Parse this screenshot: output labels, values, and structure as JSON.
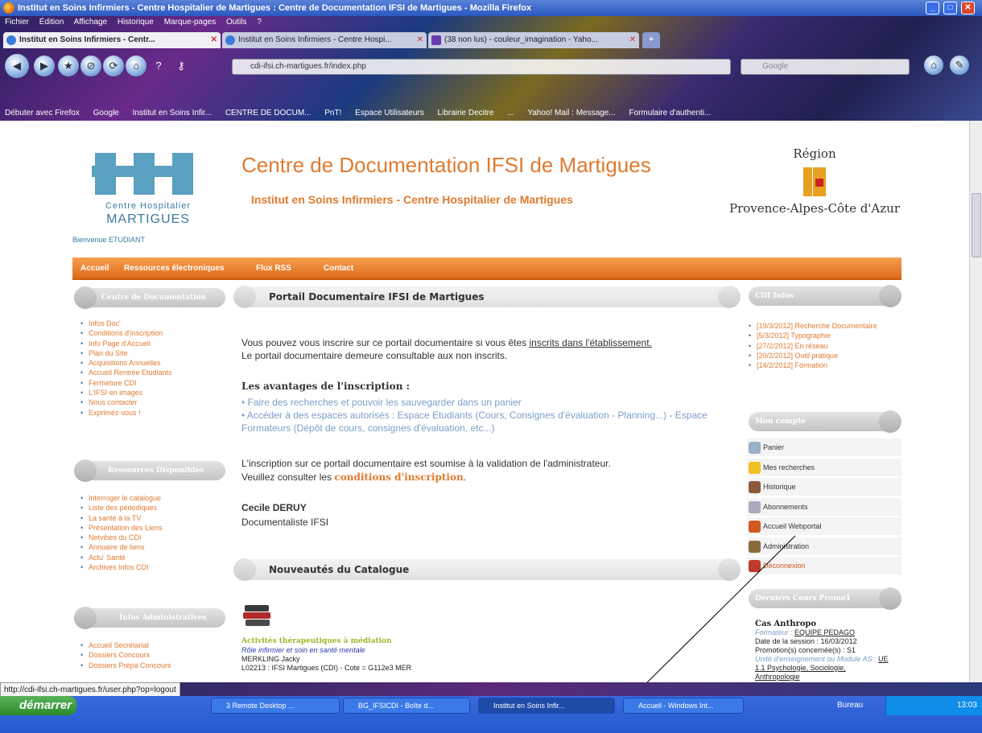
{
  "window": {
    "title": "Institut en Soins Infirmiers - Centre Hospitalier de Martigues : Centre de Documentation IFSI de Martigues - Mozilla Firefox"
  },
  "menu": [
    "Fichier",
    "Édition",
    "Affichage",
    "Historique",
    "Marque-pages",
    "Outils",
    "?"
  ],
  "tabs": [
    {
      "label": "Institut en Soins Infirmiers - Centr...",
      "active": true
    },
    {
      "label": "Institut en Soins Infirmiers - Centre Hospi...",
      "active": false
    },
    {
      "label": "(38 non lus) - couleur_imagination - Yaho...",
      "active": false
    }
  ],
  "url": "cdi-ifsi.ch-martigues.fr/index.php",
  "search": {
    "engine": "Google",
    "placeholder": "Google"
  },
  "bookmarks": [
    "Débuter avec Firefox",
    "Google",
    "Institut en Soins Infir...",
    "CENTRE DE DOCUM...",
    "PnT!",
    "Espace Utilisateurs",
    "Librairie Decitre",
    "...",
    "Yahoo! Mail : Message...",
    "Formulaire d'authenti..."
  ],
  "site": {
    "logo_line1": "Centre Hospitalier",
    "logo_line2": "MARTIGUES",
    "welcome": "Bienvenue ETUDIANT",
    "title": "Centre de Documentation IFSI de Martigues",
    "subtitle": "Institut en Soins Infirmiers - Centre Hospitalier de Martigues",
    "region_top": "Région",
    "region_bottom": "Provence-Alpes-Côte d'Azur",
    "nav": [
      "Accueil",
      "Ressources électroniques",
      "Flux RSS",
      "Contact"
    ]
  },
  "left": {
    "sec1": {
      "title": "Centre de Documentation",
      "items": [
        "Infos Doc'",
        "Conditions d'inscription",
        "Info Page d'Accueil",
        "Plan du Site",
        "Acquisitions Annuelles",
        "Accueil Rentrée Etudiants",
        "Fermeture CDI",
        "L'IFSI en images",
        "Nous contacter",
        "Exprimez-vous !"
      ]
    },
    "sec2": {
      "title": "Ressources Disponibles",
      "items": [
        "Interroger le catalogue",
        "Liste des périodiques",
        "La santé à la TV",
        "Présentation des Liens",
        "Netvibes du CDI",
        "Annuaire de liens",
        "Actu' Santé",
        "Archives Infos CDI"
      ]
    },
    "sec3": {
      "title": "Infos Administratives",
      "items": [
        "Accueil Secrétariat",
        "Dossiers Concours",
        "Dossiers Prépa Concours"
      ]
    }
  },
  "main": {
    "header": "Portail Documentaire IFSI de Martigues",
    "p1a": "Vous pouvez vous inscrire sur ce portail documentaire si vous êtes ",
    "p1link": "inscrits dans l'établissement.",
    "p1b": "Le portail documentaire demeure consultable aux non inscrits.",
    "adv_title": "Les avantages de l'inscription :",
    "adv1": "• Faire des recherches et pouvoir les sauvegarder dans un panier",
    "adv2": "• Accéder à des espaces autorisés : Espace Etudiants (Cours, Consignes d'évaluation - Planning...) - Espace Formateurs (Dépôt de cours, consignes d'évaluation, etc...)",
    "p3a": "L'inscription sur ce portail documentaire est soumise à la validation de l'administrateur.",
    "p3b": "Veuillez consulter les ",
    "p3link": "conditions d'inscription",
    "p3c": ".",
    "sig_name": "Cecile DERUY",
    "sig_role": "Documentaliste IFSI",
    "new_header": "Nouveautés du Catalogue",
    "book": {
      "title": "Activités thérapeutiques à médiation",
      "subtitle": "Rôle infirmier et soin en santé mentale",
      "author": "MERKLING Jacky",
      "ref": "L02213 : IFSI Martigues (CDI) - Cote = G112e3 MER"
    }
  },
  "right": {
    "cdi_title": "CDI Infos",
    "cdi_items": [
      "[19/3/2012] Recherche Documentaire",
      "[5/3/2012] Typographie",
      "[27/2/2012] En réseau",
      "[20/2/2012] Outil pratique",
      "[14/2/2012] Formation"
    ],
    "account_title": "Mon compte",
    "account_items": [
      {
        "label": "Panier",
        "icon": "cart-icon"
      },
      {
        "label": "Mes recherches",
        "icon": "star-icon"
      },
      {
        "label": "Historique",
        "icon": "books-icon"
      },
      {
        "label": "Abonnements",
        "icon": "rss-icon"
      },
      {
        "label": "Accueil Webportal",
        "icon": "home-icon"
      },
      {
        "label": "Administration",
        "icon": "admin-icon"
      },
      {
        "label": "Déconnexion",
        "icon": "logout-icon"
      }
    ],
    "courses_title": "Derniers Cours Promo1",
    "course_name": "Cas Anthropo",
    "course_trainer_label": "Formateur : ",
    "course_trainer": "EQUIPE PEDAGO",
    "course_date": "Date de la session : 16/03/2012",
    "course_promo": "Promotion(s) concernée(s) : S1",
    "course_unit_label": "Unité d'enseignement ou Module AS : ",
    "course_unit": "UE 1.1 Psychologie, Sociologie, Anthropologie"
  },
  "statusbar": {
    "url": "http://cdi-ifsi.ch-martigues.fr/user.php?op=logout"
  },
  "taskbar": {
    "start": "démarrer",
    "tasks": [
      "3 Remote Desktop ...",
      "BG_IFSICDI - Boîte d...",
      "Institut en Soins Infir...",
      "Accueil - Windows Int..."
    ],
    "bureau": "Bureau",
    "clock": "13:03"
  }
}
